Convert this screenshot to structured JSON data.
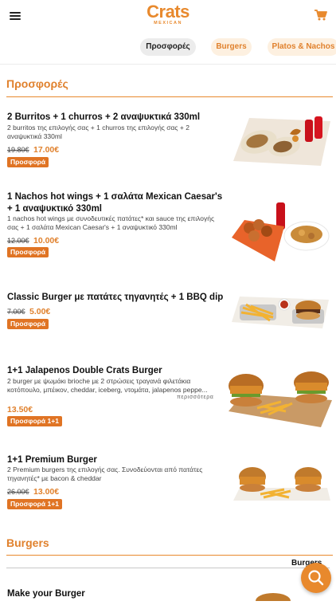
{
  "header": {
    "logo_main": "Crats",
    "logo_sub": "MEXICAN",
    "tabs": [
      {
        "label": "Προσφορές",
        "active": true
      },
      {
        "label": "Burgers",
        "active": false
      },
      {
        "label": "Platos & Nachos",
        "active": false
      }
    ]
  },
  "sections": [
    {
      "title": "Προσφορές"
    },
    {
      "title": "Burgers"
    }
  ],
  "offers": [
    {
      "name": "2 Burritos + 1 churros + 2 αναψυκτικά 330ml",
      "description": "2 burritos της επιλογής σας + 1 churros της επιλογής σας + 2 αναψυκτικά 330ml",
      "old_price": "19.80€",
      "price": "17.00€",
      "badge": "Προσφορά"
    },
    {
      "name": "1 Nachos hot wings + 1 σαλάτα Mexican Caesar's + 1 αναψυκτικό 330ml",
      "description": "1 nachos hot wings με συνοδευτικές πατάτες* και sauce της επιλογής σας + 1 σαλάτα Mexican Caesar's + 1 αναψυκτικό 330ml",
      "old_price": "12.00€",
      "price": "10.00€",
      "badge": "Προσφορά"
    },
    {
      "name": "Classic Burger με πατάτες τηγανητές + 1 BBQ dip",
      "old_price": "7.00€",
      "price": "5.00€",
      "badge": "Προσφορά"
    },
    {
      "name": "1+1 Jalapenos Double Crats Burger",
      "description": "2 burger με ψωμάκι brioche με 2 στρώσεις τραγανά φιλετάκια κοτόπουλο, μπέικον, cheddar, iceberg, ντομάτα, jalapenos peppe...",
      "more": "περισσότερα",
      "price": "13.50€",
      "badge": "Προσφορά 1+1"
    },
    {
      "name": "1+1 Premium Burger",
      "description": "2 Premium burgers της επιλογής σας. Συνοδεύονται από πατάτες τηγανητές* με bacon & cheddar",
      "old_price": "26.00€",
      "price": "13.00€",
      "badge": "Προσφορά 1+1"
    }
  ],
  "burgers": {
    "first_item_name": "Make your Burger",
    "strip_label": "Burgers"
  },
  "icons": {
    "menu": "hamburger-menu-icon",
    "cart": "shopping-cart-icon",
    "search": "search-icon"
  },
  "colors": {
    "accent": "#e8892d",
    "badge": "#e07424",
    "tab_active_bg": "#ececec",
    "tab_inactive_bg": "#fdf0e0"
  }
}
